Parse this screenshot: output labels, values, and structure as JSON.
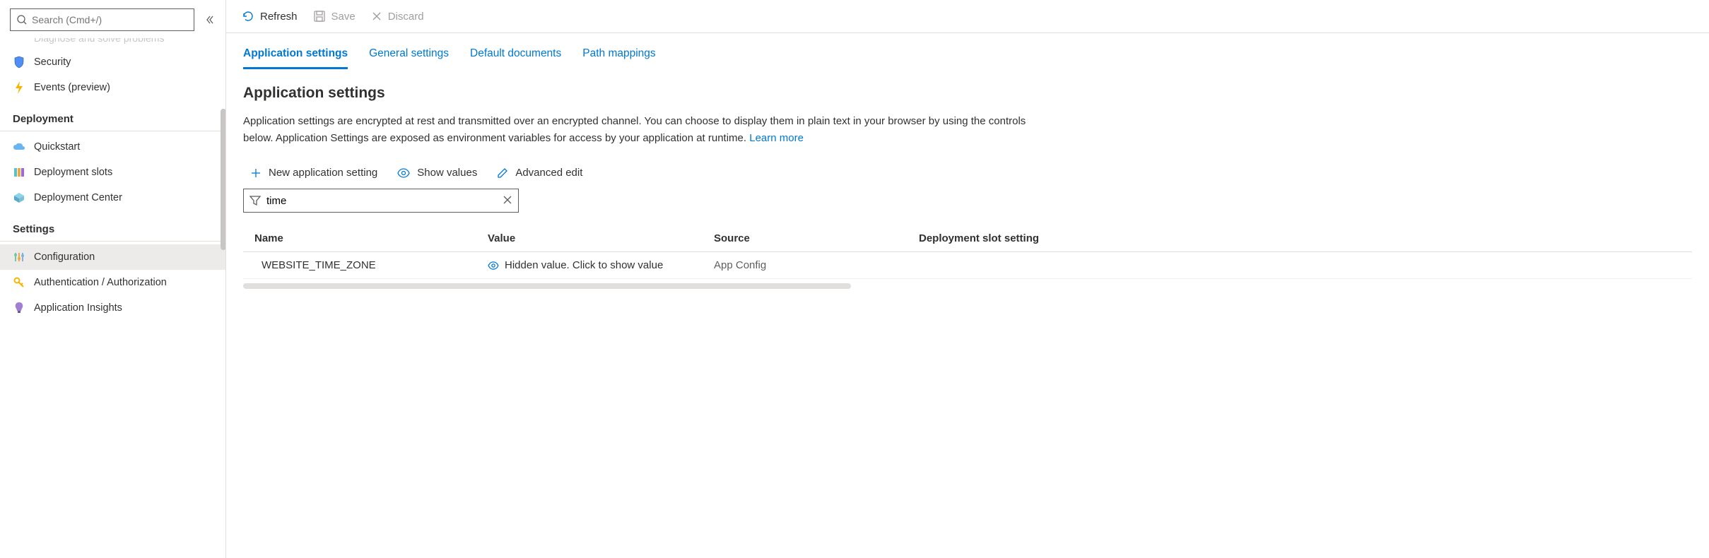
{
  "sidebar": {
    "search_placeholder": "Search (Cmd+/)",
    "partial_item": "Diagnose and solve problems",
    "items_top": [
      {
        "key": "security",
        "label": "Security"
      },
      {
        "key": "events",
        "label": "Events (preview)"
      }
    ],
    "groups": [
      {
        "title": "Deployment",
        "items": [
          {
            "key": "quickstart",
            "label": "Quickstart"
          },
          {
            "key": "slots",
            "label": "Deployment slots"
          },
          {
            "key": "center",
            "label": "Deployment Center"
          }
        ]
      },
      {
        "title": "Settings",
        "items": [
          {
            "key": "configuration",
            "label": "Configuration",
            "active": true
          },
          {
            "key": "auth",
            "label": "Authentication / Authorization"
          },
          {
            "key": "insights",
            "label": "Application Insights"
          }
        ]
      }
    ]
  },
  "toolbar": {
    "refresh": "Refresh",
    "save": "Save",
    "discard": "Discard"
  },
  "tabs": [
    {
      "key": "app-settings",
      "label": "Application settings",
      "active": true
    },
    {
      "key": "general",
      "label": "General settings"
    },
    {
      "key": "default-docs",
      "label": "Default documents"
    },
    {
      "key": "path-mappings",
      "label": "Path mappings"
    }
  ],
  "section": {
    "title": "Application settings",
    "description_main": "Application settings are encrypted at rest and transmitted over an encrypted channel. You can choose to display them in plain text in your browser by using the controls below. Application Settings are exposed as environment variables for access by your application at runtime. ",
    "learn_more": "Learn more"
  },
  "actions": {
    "new_setting": "New application setting",
    "show_values": "Show values",
    "advanced_edit": "Advanced edit"
  },
  "filter": {
    "value": "time"
  },
  "table": {
    "headers": {
      "name": "Name",
      "value": "Value",
      "source": "Source",
      "slot": "Deployment slot setting"
    },
    "rows": [
      {
        "name": "WEBSITE_TIME_ZONE",
        "value_text": "Hidden value. Click to show value",
        "source": "App Config",
        "slot": ""
      }
    ]
  }
}
